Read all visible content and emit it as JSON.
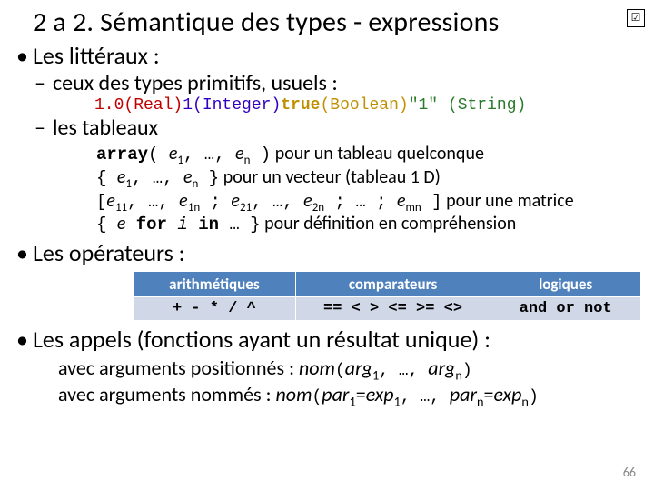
{
  "title": "2 a 2. Sémantique des types - expressions",
  "check_glyph": "☑",
  "literals": {
    "heading": "Les littéraux :",
    "prims_heading": "ceux des types primitifs, usuels :",
    "prims_line": {
      "v1": "1.0",
      "t1": "(Real)",
      "v2": "1",
      "t2": "(Integer)",
      "v3": "true",
      "t3": "(Boolean)",
      "v4": "\"1\"",
      "t4": "(String)"
    },
    "arrays_heading": "les tableaux",
    "arrays": {
      "l1a": "array",
      "l1b": "( ",
      "l1c": "e",
      "l1d": ", …, ",
      "l1e": "e",
      "l1f": " )",
      "l1g": " pour un tableau quelconque",
      "l2a": "{ ",
      "l2b": "e",
      "l2c": ", …, ",
      "l2d": "e",
      "l2e": " }",
      "l2f": " pour un vecteur (tableau 1 D)",
      "l3a": "[",
      "l3b": "e",
      "l3c": ", …, ",
      "l3d": "e",
      "l3e": " ; ",
      "l3f": "e",
      "l3g": ", …, ",
      "l3h": "e",
      "l3i": " ; … ; ",
      "l3j": "e",
      "l3k": " ]",
      "l3l": " pour une matrice",
      "l4a": "{ ",
      "l4b": "e",
      "l4c": " for ",
      "l4d": "i",
      "l4e": " in ",
      "l4f": "…",
      "l4g": " }",
      "l4h": " pour définition en compréhension"
    },
    "idx": {
      "one": "1",
      "n": "n",
      "e11": "11",
      "e1n": "1n",
      "e21": "21",
      "e2n": "2n",
      "emn": "mn"
    }
  },
  "operators": {
    "heading": "Les opérateurs :",
    "headers": {
      "arith": "arithmétiques",
      "comp": "comparateurs",
      "logic": "logiques"
    },
    "cells": {
      "arith": "+ - * / ^",
      "comp": "== < > <= >= <>",
      "logic": "and or not"
    }
  },
  "calls": {
    "heading": "Les appels (fonctions ayant un résultat unique) :",
    "pos_pre": "avec arguments positionnés : ",
    "named_pre": "avec arguments nommés : ",
    "nom": "nom",
    "open": "(",
    "close": ")",
    "arg": "arg",
    "par": "par",
    "exp": "exp",
    "sep": ", …, ",
    "eq": "="
  },
  "idx": {
    "one": "1",
    "n": "n"
  },
  "page_number": "66"
}
